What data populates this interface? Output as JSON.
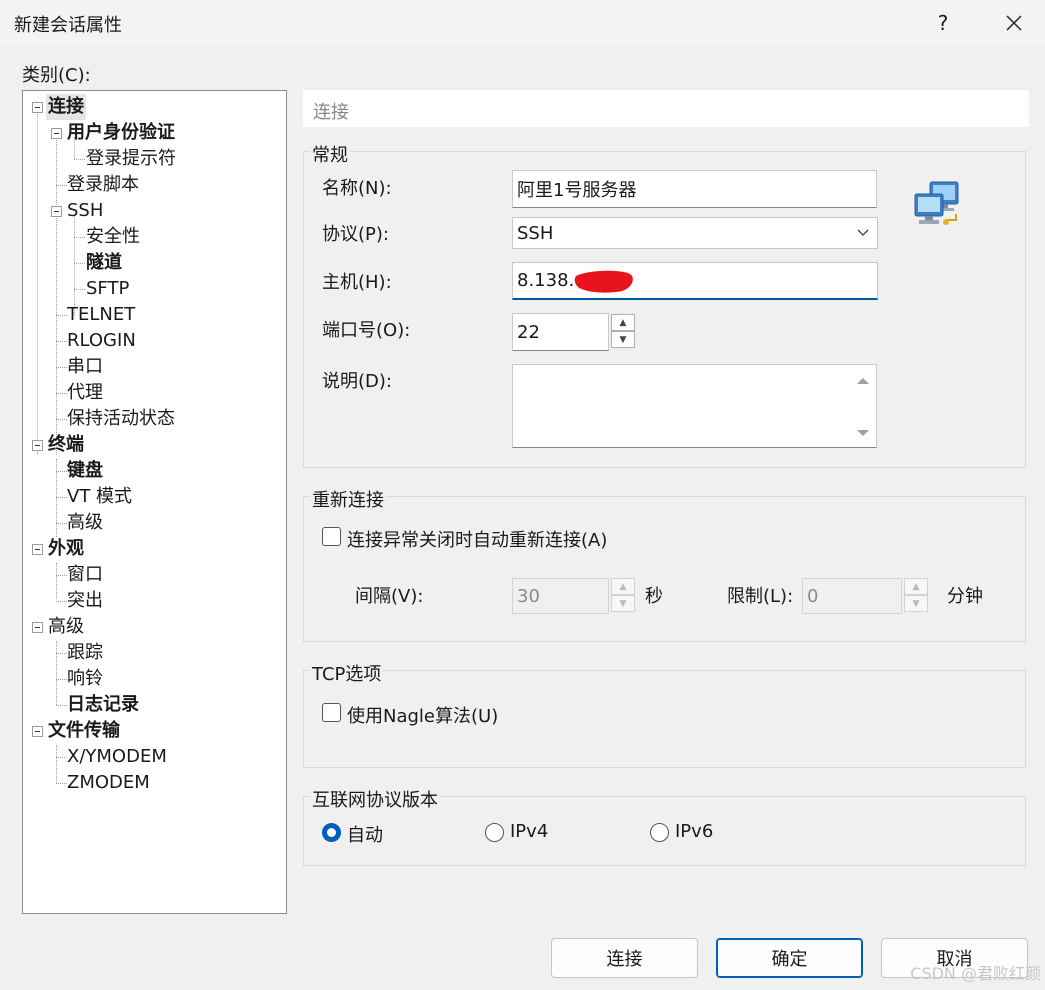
{
  "window": {
    "title": "新建会话属性",
    "help": "?"
  },
  "category_label": "类别(C):",
  "tree": {
    "connection": "连接",
    "user_auth": "用户身份验证",
    "login_prompt": "登录提示符",
    "login_script": "登录脚本",
    "ssh": "SSH",
    "security": "安全性",
    "tunnel": "隧道",
    "sftp": "SFTP",
    "telnet": "TELNET",
    "rlogin": "RLOGIN",
    "serial": "串口",
    "proxy": "代理",
    "keepalive": "保持活动状态",
    "terminal": "终端",
    "keyboard": "键盘",
    "vt_mode": "VT 模式",
    "advanced_term": "高级",
    "appearance": "外观",
    "window": "窗口",
    "highlight": "突出",
    "advanced": "高级",
    "trace": "跟踪",
    "bell": "响铃",
    "logging": "日志记录",
    "file_transfer": "文件传输",
    "xymodem": "X/YMODEM",
    "zmodem": "ZMODEM"
  },
  "section_title": "连接",
  "general": {
    "legend": "常规",
    "name_label": "名称(N):",
    "name_value": "阿里1号服务器",
    "protocol_label": "协议(P):",
    "protocol_value": "SSH",
    "host_label": "主机(H):",
    "host_value": "8.138.",
    "port_label": "端口号(O):",
    "port_value": "22",
    "desc_label": "说明(D):",
    "desc_value": ""
  },
  "reconnect": {
    "legend": "重新连接",
    "auto_label": "连接异常关闭时自动重新连接(A)",
    "interval_label": "间隔(V):",
    "interval_value": "30",
    "interval_unit": "秒",
    "limit_label": "限制(L):",
    "limit_value": "0",
    "limit_unit": "分钟"
  },
  "tcp": {
    "legend": "TCP选项",
    "nagle_label": "使用Nagle算法(U)"
  },
  "ipver": {
    "legend": "互联网协议版本",
    "auto": "自动",
    "ipv4": "IPv4",
    "ipv6": "IPv6",
    "selected": "auto"
  },
  "buttons": {
    "connect": "连接",
    "ok": "确定",
    "cancel": "取消"
  },
  "watermark": "CSDN @君败红颜",
  "colors": {
    "accent": "#005fb8",
    "redaction": "#e8141b"
  }
}
